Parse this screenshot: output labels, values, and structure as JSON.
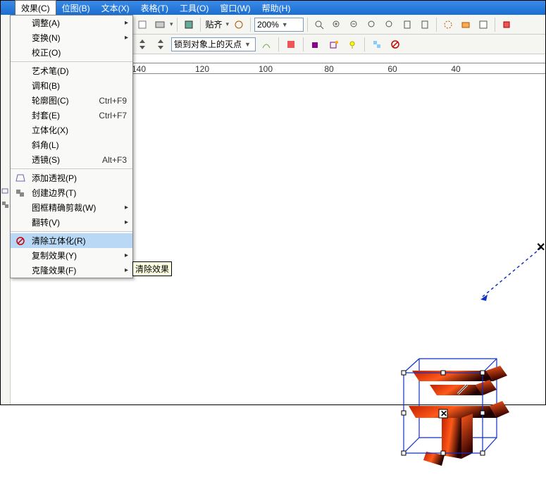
{
  "menubar": {
    "items": [
      {
        "label": "效果(C)",
        "open": true
      },
      {
        "label": "位图(B)"
      },
      {
        "label": "文本(X)"
      },
      {
        "label": "表格(T)"
      },
      {
        "label": "工具(O)"
      },
      {
        "label": "窗口(W)"
      },
      {
        "label": "帮助(H)"
      }
    ]
  },
  "dropdown": {
    "items": [
      {
        "label": "调整(A)",
        "sub": true
      },
      {
        "label": "变换(N)",
        "sub": true
      },
      {
        "label": "校正(O)"
      },
      {
        "sep": true
      },
      {
        "label": "艺术笔(D)"
      },
      {
        "label": "调和(B)"
      },
      {
        "label": "轮廓图(C)",
        "shortcut": "Ctrl+F9"
      },
      {
        "label": "封套(E)",
        "shortcut": "Ctrl+F7"
      },
      {
        "label": "立体化(X)"
      },
      {
        "label": "斜角(L)"
      },
      {
        "label": "透镜(S)",
        "shortcut": "Alt+F3"
      },
      {
        "sep": true
      },
      {
        "label": "添加透视(P)",
        "icon": "perspective"
      },
      {
        "label": "创建边界(T)",
        "icon": "boundary"
      },
      {
        "label": "图框精确剪裁(W)",
        "sub": true
      },
      {
        "label": "翻转(V)",
        "sub": true
      },
      {
        "sep": true
      },
      {
        "label": "清除立体化(R)",
        "highlight": true,
        "icon": "clear"
      },
      {
        "label": "复制效果(Y)",
        "sub": true
      },
      {
        "label": "克隆效果(F)",
        "sub": true
      }
    ]
  },
  "tooltip": "清除效果",
  "toolbar1": {
    "paste_label": "贴齐",
    "zoom_value": "200%"
  },
  "toolbar2": {
    "snap_label": "锁到对象上的灭点"
  },
  "ruler": {
    "ticks": [
      {
        "pos": 180,
        "n": "140"
      },
      {
        "pos": 270,
        "n": "120"
      },
      {
        "pos": 360,
        "n": "100"
      },
      {
        "pos": 450,
        "n": "80"
      },
      {
        "pos": 540,
        "n": "60"
      },
      {
        "pos": 630,
        "n": "40"
      }
    ]
  }
}
